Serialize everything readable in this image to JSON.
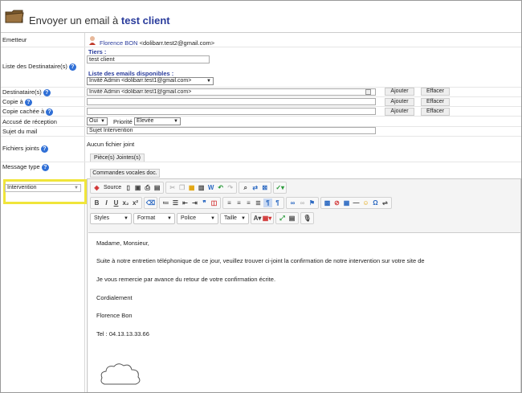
{
  "header": {
    "title_prefix": "Envoyer un email à",
    "title_name": "test client"
  },
  "form": {
    "emetteur_label": "Emetteur",
    "emetteur_name": "Florence BON",
    "emetteur_email": "<dolibarr.test2@gmail.com>",
    "destinataires_label": "Liste des Destinataire(s)",
    "tiers_label": "Tiers :",
    "tiers_value": "test client",
    "emails_label": "Liste des emails disponibles :",
    "emails_select": "Invité Admin <dolibarr.test1@gmail.com>",
    "dest_label": "Destinataire(s)",
    "dest_value": "Invité Admin <dolibarr.test1@gmail.com>",
    "copie_label": "Copie à",
    "copie_cachee_label": "Copie cachée à",
    "accuse_label": "Accusé de réception",
    "accuse_value": "Oui",
    "priorite_label": "Priorité",
    "priorite_value": "Elevée",
    "sujet_label": "Sujet du mail",
    "sujet_value": "Sujet Intervention",
    "fichiers_label": "Fichiers joints",
    "aucun_fichier": "Aucun fichier joint",
    "pieces_button": "Pièce(s) Jointes(s)",
    "modele_label": "Message type",
    "commandes_button": "Commandes vocales doc.",
    "modele_value": "Intervention",
    "ajouter": "Ajouter",
    "effacer": "Effacer"
  },
  "editor": {
    "source_label": "Source",
    "styles": "Styles",
    "format": "Format",
    "police": "Police",
    "taille": "Taille",
    "paragraphs": [
      "Madame, Monsieur,",
      "Suite à notre entretien téléphonique de ce jour, veuillez trouver ci-joint la confirmation de notre intervention sur votre site de",
      "Je vous remercie par avance du retour de  votre confirmation écrite.",
      "Cordialement",
      "Florence Bon",
      "Tel : 04.13.13.33.66"
    ]
  },
  "colors": {
    "title_name": "#2a3c9c",
    "help_icon": "#2f6fd6",
    "highlight": "#f0e53a"
  }
}
